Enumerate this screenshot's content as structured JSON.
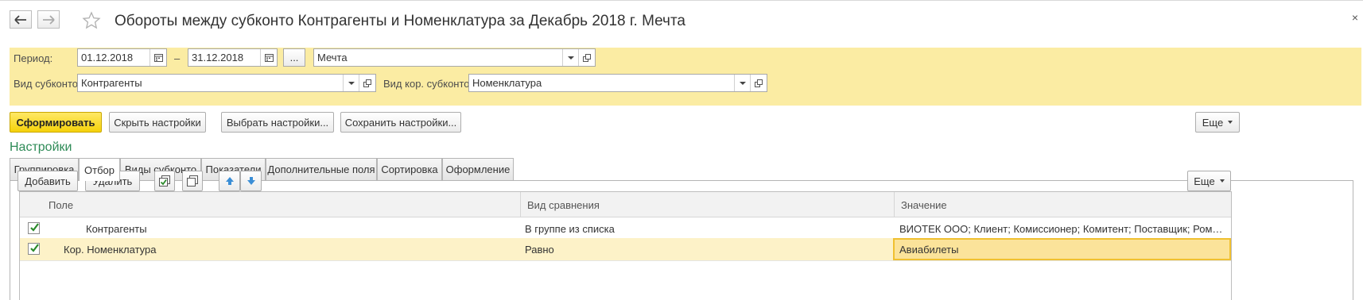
{
  "window": {
    "title": "Обороты между субконто Контрагенты и Номенклатура за Декабрь 2018 г. Мечта",
    "close_glyph": "×"
  },
  "params": {
    "period_label": "Период:",
    "date_from": "01.12.2018",
    "dash": "–",
    "date_to": "31.12.2018",
    "ellipsis": "...",
    "organization": "Мечта",
    "subconto_label": "Вид субконто:",
    "subconto_value": "Контрагенты",
    "cor_subconto_label": "Вид кор. субконто:",
    "cor_subconto_value": "Номенклатура"
  },
  "toolbar": {
    "generate": "Сформировать",
    "hide_settings": "Скрыть настройки",
    "choose_settings": "Выбрать настройки...",
    "save_settings": "Сохранить настройки...",
    "more": "Еще"
  },
  "settings": {
    "title": "Настройки",
    "tabs": [
      {
        "label": "Группировка"
      },
      {
        "label": "Отбор"
      },
      {
        "label": "Виды субконто"
      },
      {
        "label": "Показатели"
      },
      {
        "label": "Дополнительные поля"
      },
      {
        "label": "Сортировка"
      },
      {
        "label": "Оформление"
      }
    ],
    "active_tab": "Отбор"
  },
  "filter_toolbar": {
    "add": "Добавить",
    "delete": "Удалить",
    "more": "Еще"
  },
  "filter_table": {
    "columns": [
      "Поле",
      "Вид сравнения",
      "Значение"
    ],
    "rows": [
      {
        "checked": true,
        "field": "Контрагенты",
        "comparison": "В группе из списка",
        "value": "ВИОТЕК ООО; Клиент; Комиссионер; Комитент; Поставщик; Ромашка; Сервис-Плюс; Эльдорадо"
      },
      {
        "checked": true,
        "field": "Кор. Номенклатура",
        "comparison": "Равно",
        "value": "Авиабилеты"
      }
    ]
  },
  "colors": {
    "params_bg": "#fbeca3",
    "primary_button": "#f5d20a",
    "section_title": "#2e8b57",
    "selected_row": "#fdf2c8"
  }
}
